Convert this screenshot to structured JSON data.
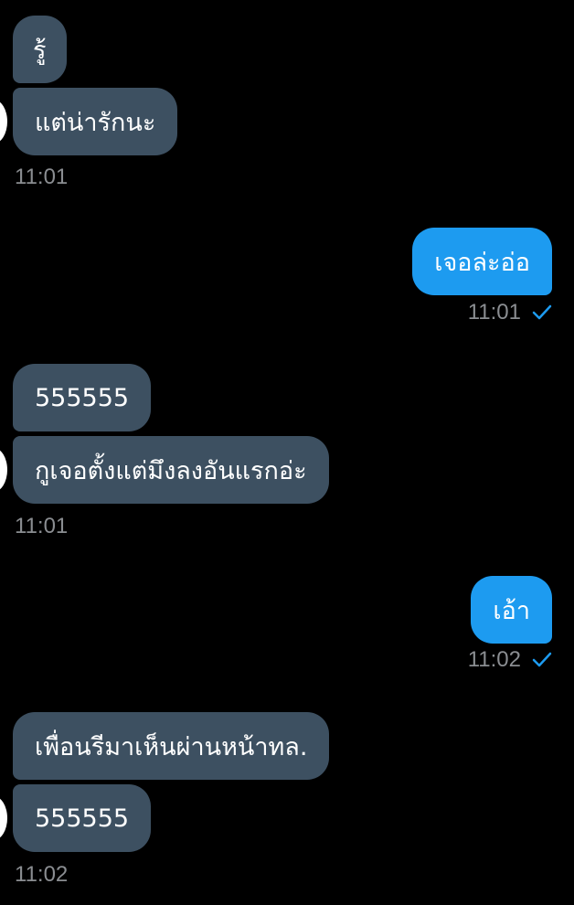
{
  "conversation": {
    "groups": [
      {
        "direction": "in",
        "messages": [
          "รู้",
          "แต่น่ารักนะ"
        ],
        "time": "11:01"
      },
      {
        "direction": "out",
        "messages": [
          "เจอล่ะอ่อ"
        ],
        "time": "11:01",
        "status": "sent"
      },
      {
        "direction": "in",
        "messages": [
          "555555",
          "กูเจอตั้งแต่มึงลงอันแรกอ่ะ"
        ],
        "time": "11:01"
      },
      {
        "direction": "out",
        "messages": [
          "เอ้า"
        ],
        "time": "11:02",
        "status": "sent"
      },
      {
        "direction": "in",
        "messages": [
          "เพื่อนรีมาเห็นผ่านหน้าทล.",
          "555555"
        ],
        "time": "11:02"
      }
    ]
  },
  "colors": {
    "background": "#000000",
    "incoming_bubble": "#3d5061",
    "outgoing_bubble": "#1d9bf0",
    "timestamp": "#8a8d91",
    "check": "#1d9bf0"
  },
  "icons": {
    "sent_status": "checkmark-icon",
    "sender_avatar": "avatar"
  }
}
